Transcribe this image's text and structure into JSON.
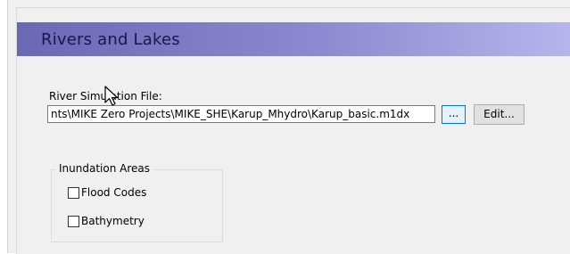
{
  "section": {
    "title": "Rivers and Lakes"
  },
  "river_sim": {
    "label": "River Simulation File:",
    "value": "nts\\MIKE Zero Projects\\MIKE_SHE\\Karup_Mhydro\\Karup_basic.m1dx",
    "browse_label": "...",
    "edit_label": "Edit..."
  },
  "inundation": {
    "title": "Inundation Areas",
    "options": [
      {
        "label": "Flood Codes",
        "checked": false
      },
      {
        "label": "Bathymetry",
        "checked": false
      }
    ]
  },
  "colors": {
    "header_start": "#6a68b4",
    "header_end": "#b7b5ec",
    "header_text": "#1a1650",
    "focus_border": "#0078d7"
  },
  "icons": {
    "cursor": "mouse-pointer-icon"
  }
}
